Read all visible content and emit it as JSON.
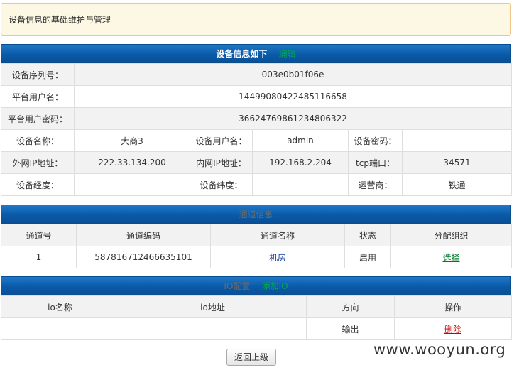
{
  "notice": {
    "text": "设备信息的基础维护与管理"
  },
  "device_info": {
    "header_title": "设备信息如下",
    "header_link": "编辑",
    "serial": {
      "label": "设备序列号：",
      "value": "003e0b01f06e"
    },
    "platform_user": {
      "label": "平台用户名：",
      "value": "14499080422485116658"
    },
    "platform_pwd": {
      "label": "平台用户密码：",
      "value": "36624769861234806322"
    },
    "row4": [
      {
        "label": "设备名称：",
        "value": "大商3"
      },
      {
        "label": "设备用户名：",
        "value": "admin"
      },
      {
        "label": "设备密码：",
        "value": ""
      }
    ],
    "row5": [
      {
        "label": "外网IP地址：",
        "value": "222.33.134.200"
      },
      {
        "label": "内网IP地址：",
        "value": "192.168.2.204"
      },
      {
        "label": "tcp端口：",
        "value": "34571"
      }
    ],
    "row6": [
      {
        "label": "设备经度：",
        "value": ""
      },
      {
        "label": "设备纬度：",
        "value": ""
      },
      {
        "label": "运营商：",
        "value": "铁通"
      }
    ]
  },
  "channel_info": {
    "header_title": "通道信息",
    "columns": [
      "通道号",
      "通道编码",
      "通道名称",
      "状态",
      "分配组织"
    ],
    "rows": [
      {
        "no": "1",
        "code": "587816712466635101",
        "name": "机房",
        "status": "启用",
        "action": "选择"
      }
    ]
  },
  "io_config": {
    "header_title": "IO配置",
    "header_link": "添加IO",
    "columns": [
      "io名称",
      "io地址",
      "方向",
      "操作"
    ],
    "rows": [
      {
        "name": "",
        "address": "",
        "direction": "输出",
        "action": "删除"
      }
    ]
  },
  "back_button": "返回上级",
  "watermark": "www.wooyun.org",
  "colors": {
    "header_blue": "#0a5aa8",
    "link_green": "#00a651",
    "delete_red": "#cc0000",
    "notice_bg": "#fcf8e3"
  }
}
